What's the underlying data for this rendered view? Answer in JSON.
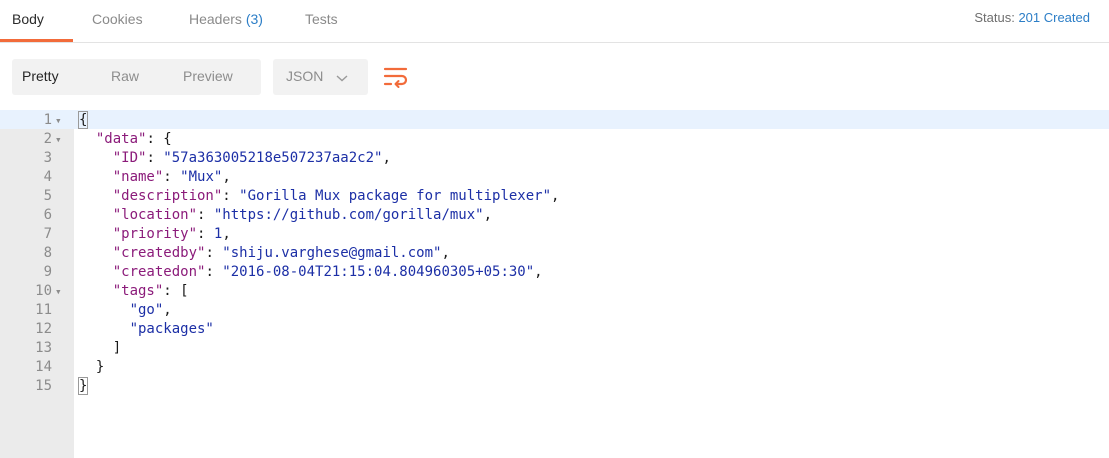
{
  "tabs": [
    {
      "label": "Body",
      "active": true
    },
    {
      "label": "Cookies",
      "active": false
    },
    {
      "label": "Headers",
      "count": "(3)",
      "active": false
    },
    {
      "label": "Tests",
      "active": false
    }
  ],
  "status": {
    "label": "Status:",
    "value": "201 Created"
  },
  "view_modes": [
    {
      "label": "Pretty",
      "active": true
    },
    {
      "label": "Raw",
      "active": false
    },
    {
      "label": "Preview",
      "active": false
    }
  ],
  "format_select": {
    "value": "JSON",
    "icon": "chevron-down-icon"
  },
  "wrap_button": {
    "icon": "wrap-lines-icon"
  },
  "colors": {
    "accent": "#f26b3a",
    "link": "#2c7ec7",
    "key": "#8b1b7a",
    "string": "#1c2fa6"
  },
  "code_lines": [
    {
      "n": "1",
      "fold": true,
      "indent": "",
      "tokens": [
        {
          "t": "p",
          "v": "{"
        }
      ]
    },
    {
      "n": "2",
      "fold": true,
      "indent": "  ",
      "tokens": [
        {
          "t": "k",
          "v": "\"data\""
        },
        {
          "t": "p",
          "v": ": {"
        }
      ]
    },
    {
      "n": "3",
      "fold": false,
      "indent": "    ",
      "tokens": [
        {
          "t": "k",
          "v": "\"ID\""
        },
        {
          "t": "p",
          "v": ": "
        },
        {
          "t": "s",
          "v": "\"57a363005218e507237aa2c2\""
        },
        {
          "t": "p",
          "v": ","
        }
      ]
    },
    {
      "n": "4",
      "fold": false,
      "indent": "    ",
      "tokens": [
        {
          "t": "k",
          "v": "\"name\""
        },
        {
          "t": "p",
          "v": ": "
        },
        {
          "t": "s",
          "v": "\"Mux\""
        },
        {
          "t": "p",
          "v": ","
        }
      ]
    },
    {
      "n": "5",
      "fold": false,
      "indent": "    ",
      "tokens": [
        {
          "t": "k",
          "v": "\"description\""
        },
        {
          "t": "p",
          "v": ": "
        },
        {
          "t": "s",
          "v": "\"Gorilla Mux package for multiplexer\""
        },
        {
          "t": "p",
          "v": ","
        }
      ]
    },
    {
      "n": "6",
      "fold": false,
      "indent": "    ",
      "tokens": [
        {
          "t": "k",
          "v": "\"location\""
        },
        {
          "t": "p",
          "v": ": "
        },
        {
          "t": "s",
          "v": "\"https://github.com/gorilla/mux\""
        },
        {
          "t": "p",
          "v": ","
        }
      ]
    },
    {
      "n": "7",
      "fold": false,
      "indent": "    ",
      "tokens": [
        {
          "t": "k",
          "v": "\"priority\""
        },
        {
          "t": "p",
          "v": ": "
        },
        {
          "t": "n",
          "v": "1"
        },
        {
          "t": "p",
          "v": ","
        }
      ]
    },
    {
      "n": "8",
      "fold": false,
      "indent": "    ",
      "tokens": [
        {
          "t": "k",
          "v": "\"createdby\""
        },
        {
          "t": "p",
          "v": ": "
        },
        {
          "t": "s",
          "v": "\"shiju.varghese@gmail.com\""
        },
        {
          "t": "p",
          "v": ","
        }
      ]
    },
    {
      "n": "9",
      "fold": false,
      "indent": "    ",
      "tokens": [
        {
          "t": "k",
          "v": "\"createdon\""
        },
        {
          "t": "p",
          "v": ": "
        },
        {
          "t": "s",
          "v": "\"2016-08-04T21:15:04.804960305+05:30\""
        },
        {
          "t": "p",
          "v": ","
        }
      ]
    },
    {
      "n": "10",
      "fold": true,
      "indent": "    ",
      "tokens": [
        {
          "t": "k",
          "v": "\"tags\""
        },
        {
          "t": "p",
          "v": ": ["
        }
      ]
    },
    {
      "n": "11",
      "fold": false,
      "indent": "      ",
      "tokens": [
        {
          "t": "s",
          "v": "\"go\""
        },
        {
          "t": "p",
          "v": ","
        }
      ]
    },
    {
      "n": "12",
      "fold": false,
      "indent": "      ",
      "tokens": [
        {
          "t": "s",
          "v": "\"packages\""
        }
      ]
    },
    {
      "n": "13",
      "fold": false,
      "indent": "    ",
      "tokens": [
        {
          "t": "p",
          "v": "]"
        }
      ]
    },
    {
      "n": "14",
      "fold": false,
      "indent": "  ",
      "tokens": [
        {
          "t": "p",
          "v": "}"
        }
      ]
    },
    {
      "n": "15",
      "fold": false,
      "indent": "",
      "tokens": [
        {
          "t": "p",
          "v": "}"
        }
      ]
    }
  ]
}
